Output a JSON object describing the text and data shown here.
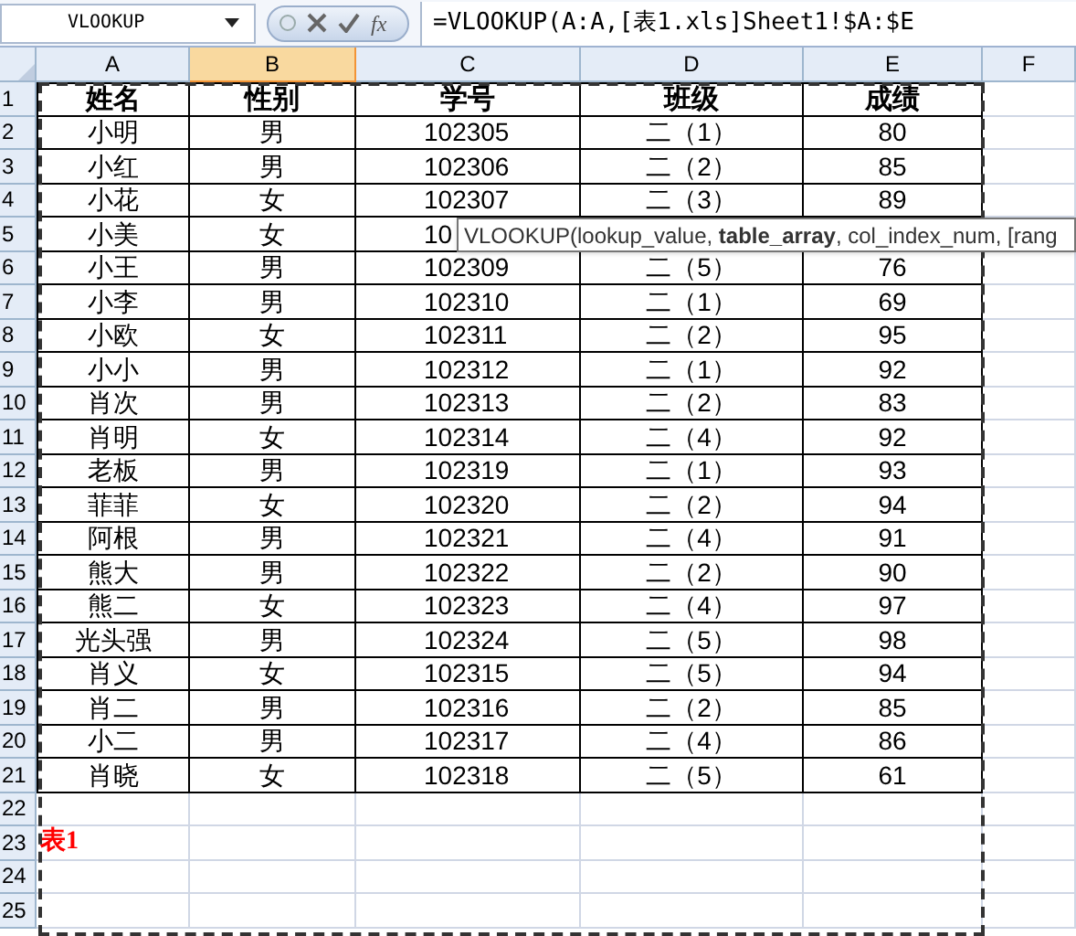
{
  "name_box": "VLOOKUP",
  "function_button": "fx",
  "formula": "=VLOOKUP(A:A,[表1.xls]Sheet1!$A:$E",
  "columns": [
    {
      "label": "A",
      "selected": false
    },
    {
      "label": "B",
      "selected": true
    },
    {
      "label": "C",
      "selected": false
    },
    {
      "label": "D",
      "selected": false
    },
    {
      "label": "E",
      "selected": false
    },
    {
      "label": "F",
      "selected": false
    }
  ],
  "rows": [
    {
      "number": "1",
      "kind": "header",
      "cells": [
        "姓名",
        "性别",
        "学号",
        "班级",
        "成绩"
      ]
    },
    {
      "number": "2",
      "kind": "data",
      "cells": [
        "小明",
        "男",
        "102305",
        "二（1）",
        "80"
      ]
    },
    {
      "number": "3",
      "kind": "data",
      "cells": [
        "小红",
        "男",
        "102306",
        "二（2）",
        "85"
      ]
    },
    {
      "number": "4",
      "kind": "data",
      "cells": [
        "小花",
        "女",
        "102307",
        "二（3）",
        "89"
      ]
    },
    {
      "number": "5",
      "kind": "data",
      "cells": [
        "小美",
        "女",
        "10"
      ]
    },
    {
      "number": "6",
      "kind": "data",
      "cells": [
        "小王",
        "男",
        "102309",
        "二（5）",
        "76"
      ]
    },
    {
      "number": "7",
      "kind": "data",
      "cells": [
        "小李",
        "男",
        "102310",
        "二（1）",
        "69"
      ]
    },
    {
      "number": "8",
      "kind": "data",
      "cells": [
        "小欧",
        "女",
        "102311",
        "二（2）",
        "95"
      ]
    },
    {
      "number": "9",
      "kind": "data",
      "cells": [
        "小小",
        "男",
        "102312",
        "二（1）",
        "92"
      ]
    },
    {
      "number": "10",
      "kind": "data",
      "cells": [
        "肖次",
        "男",
        "102313",
        "二（2）",
        "83"
      ]
    },
    {
      "number": "11",
      "kind": "data",
      "cells": [
        "肖明",
        "女",
        "102314",
        "二（4）",
        "92"
      ]
    },
    {
      "number": "12",
      "kind": "data",
      "cells": [
        "老板",
        "男",
        "102319",
        "二（1）",
        "93"
      ]
    },
    {
      "number": "13",
      "kind": "data",
      "cells": [
        "菲菲",
        "女",
        "102320",
        "二（2）",
        "94"
      ]
    },
    {
      "number": "14",
      "kind": "data",
      "cells": [
        "阿根",
        "男",
        "102321",
        "二（4）",
        "91"
      ]
    },
    {
      "number": "15",
      "kind": "data",
      "cells": [
        "熊大",
        "男",
        "102322",
        "二（2）",
        "90"
      ]
    },
    {
      "number": "16",
      "kind": "data",
      "cells": [
        "熊二",
        "女",
        "102323",
        "二（4）",
        "97"
      ]
    },
    {
      "number": "17",
      "kind": "data",
      "cells": [
        "光头强",
        "男",
        "102324",
        "二（5）",
        "98"
      ]
    },
    {
      "number": "18",
      "kind": "data",
      "cells": [
        "肖义",
        "女",
        "102315",
        "二（5）",
        "94"
      ]
    },
    {
      "number": "19",
      "kind": "data",
      "cells": [
        "肖二",
        "男",
        "102316",
        "二（2）",
        "85"
      ]
    },
    {
      "number": "20",
      "kind": "data",
      "cells": [
        "小二",
        "男",
        "102317",
        "二（4）",
        "86"
      ]
    },
    {
      "number": "21",
      "kind": "data",
      "cells": [
        "肖晓",
        "女",
        "102318",
        "二（5）",
        "61"
      ]
    },
    {
      "number": "22",
      "kind": "blank",
      "cells": []
    },
    {
      "number": "23",
      "kind": "note",
      "cells": [
        "表1"
      ]
    },
    {
      "number": "24",
      "kind": "blank",
      "cells": []
    },
    {
      "number": "25",
      "kind": "blank",
      "cells": []
    }
  ],
  "tooltip": "VLOOKUP(lookup_value, **table_array**, col_index_num, [rang"
}
